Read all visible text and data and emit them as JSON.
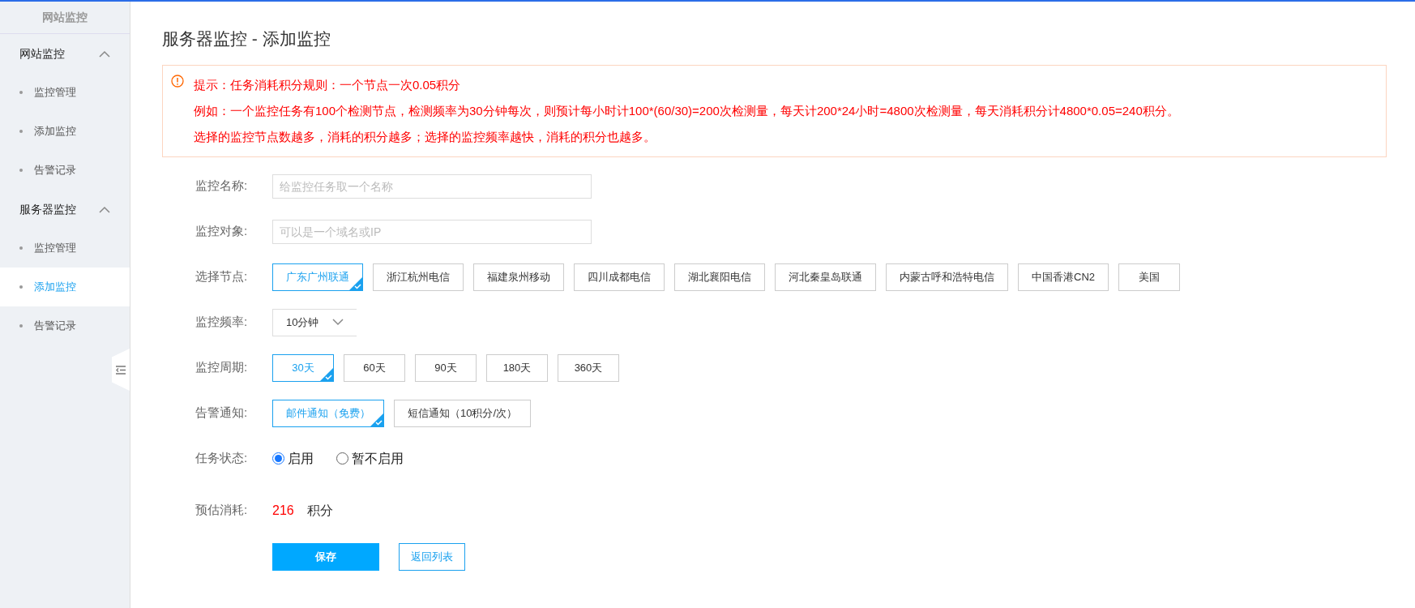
{
  "sidebar": {
    "title": "网站监控",
    "groups": [
      {
        "label": "网站监控",
        "expanded": true,
        "items": [
          {
            "label": "监控管理",
            "selected": false
          },
          {
            "label": "添加监控",
            "selected": false
          },
          {
            "label": "告警记录",
            "selected": false
          }
        ]
      },
      {
        "label": "服务器监控",
        "expanded": true,
        "items": [
          {
            "label": "监控管理",
            "selected": false
          },
          {
            "label": "添加监控",
            "selected": true
          },
          {
            "label": "告警记录",
            "selected": false
          }
        ]
      }
    ]
  },
  "page": {
    "title": "服务器监控 - 添加监控"
  },
  "alert": {
    "lines": [
      "提示：任务消耗积分规则：一个节点一次0.05积分",
      "例如：一个监控任务有100个检测节点，检测频率为30分钟每次，则预计每小时计100*(60/30)=200次检测量，每天计200*24小时=4800次检测量，每天消耗积分计4800*0.05=240积分。",
      "选择的监控节点数越多，消耗的积分越多；选择的监控频率越快，消耗的积分也越多。"
    ]
  },
  "form": [
    {
      "kind": "input",
      "label": "监控名称:",
      "placeholder": "给监控任务取一个名称"
    },
    {
      "kind": "input",
      "label": "监控对象:",
      "placeholder": "可以是一个域名或IP"
    },
    {
      "kind": "options",
      "label": "选择节点:",
      "options": [
        {
          "label": "广东广州联通",
          "selected": true
        },
        {
          "label": "浙江杭州电信",
          "selected": false
        },
        {
          "label": "福建泉州移动",
          "selected": false
        },
        {
          "label": "四川成都电信",
          "selected": false
        },
        {
          "label": "湖北襄阳电信",
          "selected": false
        },
        {
          "label": "河北秦皇岛联通",
          "selected": false
        },
        {
          "label": "内蒙古呼和浩特电信",
          "selected": false
        },
        {
          "label": "中国香港CN2",
          "selected": false
        },
        {
          "label": "美国",
          "selected": false
        }
      ]
    },
    {
      "kind": "select",
      "label": "监控频率:",
      "value": "10分钟"
    },
    {
      "kind": "options",
      "label": "监控周期:",
      "options": [
        {
          "label": "30天",
          "selected": true
        },
        {
          "label": "60天",
          "selected": false
        },
        {
          "label": "90天",
          "selected": false
        },
        {
          "label": "180天",
          "selected": false
        },
        {
          "label": "360天",
          "selected": false
        }
      ]
    },
    {
      "kind": "options",
      "label": "告警通知:",
      "options": [
        {
          "label": "邮件通知（免费）",
          "selected": true
        },
        {
          "label": "短信通知（10积分/次）",
          "selected": false
        }
      ]
    },
    {
      "kind": "radio",
      "label": "任务状态:",
      "options": [
        {
          "label": "启用",
          "selected": true
        },
        {
          "label": "暂不启用",
          "selected": false
        }
      ]
    },
    {
      "kind": "estimate",
      "label": "预估消耗:",
      "value": "216",
      "unit": "积分"
    }
  ],
  "buttons": {
    "save": "保存",
    "back": "返回列表"
  }
}
